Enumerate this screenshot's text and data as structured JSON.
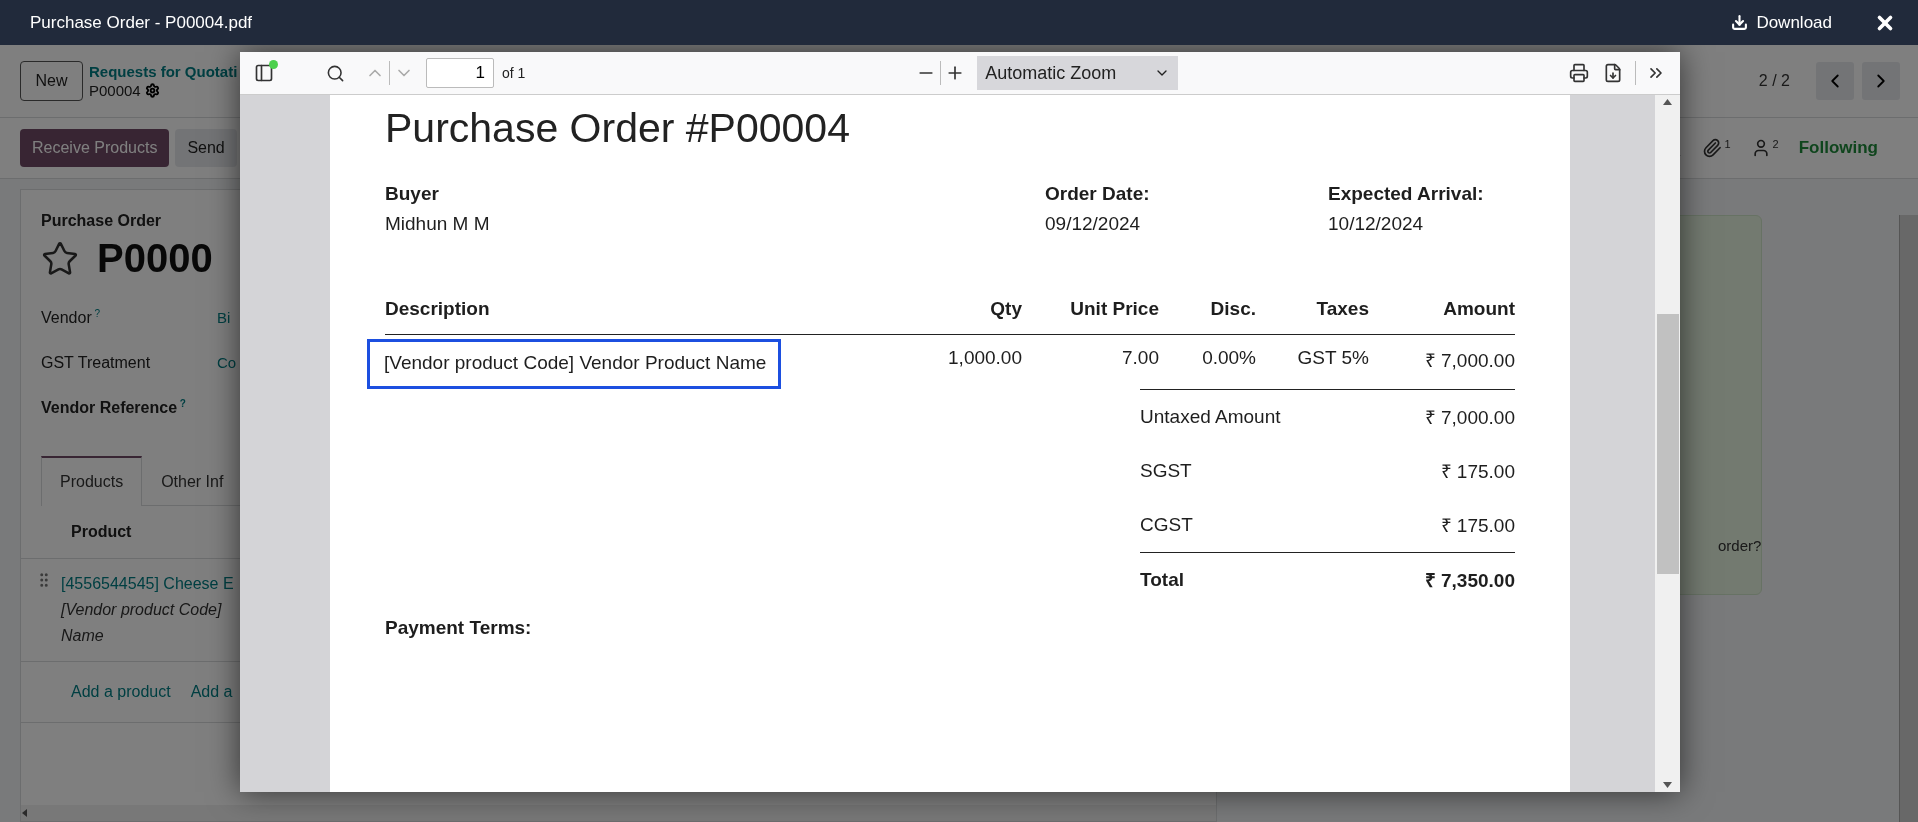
{
  "viewer_header": {
    "title": "Purchase Order - P00004.pdf",
    "download": "Download"
  },
  "breadcrumb": {
    "new_button": "New",
    "parent": "Requests for Quotati",
    "record": "P00004"
  },
  "pager": {
    "text": "2 / 2"
  },
  "status_buttons": [
    {
      "label": "Receive Products",
      "primary": true
    },
    {
      "label": "Send",
      "primary": false
    }
  ],
  "chatter": {
    "counts": [
      {
        "kind": "attachment",
        "count": "1"
      },
      {
        "kind": "follower",
        "count": "2"
      }
    ],
    "following": "Following",
    "message_fragment": "order?"
  },
  "form": {
    "type_label": "Purchase Order",
    "name": "P0000",
    "starred": false,
    "fields": [
      {
        "label": "Vendor",
        "help": "?",
        "value": "Bi",
        "bold": false
      },
      {
        "label": "GST Treatment",
        "value": "Co",
        "bold": false
      },
      {
        "label": "Vendor Reference",
        "help": "?",
        "bold": true
      }
    ],
    "tabs": [
      {
        "label": "Products",
        "selected": true
      },
      {
        "label": "Other Inf",
        "selected": false
      }
    ],
    "column_header": "Product",
    "lines": [
      {
        "product": "[4556544545] Cheese E",
        "description": "[Vendor product Code]",
        "description_2": "Name"
      }
    ],
    "add_links": [
      "Add a product",
      "Add a"
    ]
  },
  "pdf_viewer": {
    "page_number": "1",
    "page_count": "of 1",
    "zoom": "Automatic Zoom",
    "document": {
      "title": "Purchase Order #P00004",
      "info": [
        {
          "label": "Buyer",
          "value": "Midhun M M"
        },
        {
          "label": "Order Date:",
          "value": "09/12/2024"
        },
        {
          "label": "Expected Arrival:",
          "value": "10/12/2024"
        }
      ],
      "columns": [
        "Description",
        "Qty",
        "Unit Price",
        "Disc.",
        "Taxes",
        "Amount"
      ],
      "rows": [
        {
          "cells": [
            "[Vendor product Code] Vendor Product Name",
            "1,000.00",
            "7.00",
            "0.00%",
            "GST 5%",
            "₹ 7,000.00"
          ],
          "highlighted": true
        }
      ],
      "totals": [
        {
          "label": "Untaxed Amount",
          "value": "₹ 7,000.00",
          "bold": false
        },
        {
          "label": "SGST",
          "value": "₹ 175.00",
          "bold": false
        },
        {
          "label": "CGST",
          "value": "₹ 175.00",
          "bold": false
        },
        {
          "label": "Total",
          "value": "₹ 7,350.00",
          "bold": true
        }
      ],
      "payment_terms": "Payment Terms:"
    }
  }
}
